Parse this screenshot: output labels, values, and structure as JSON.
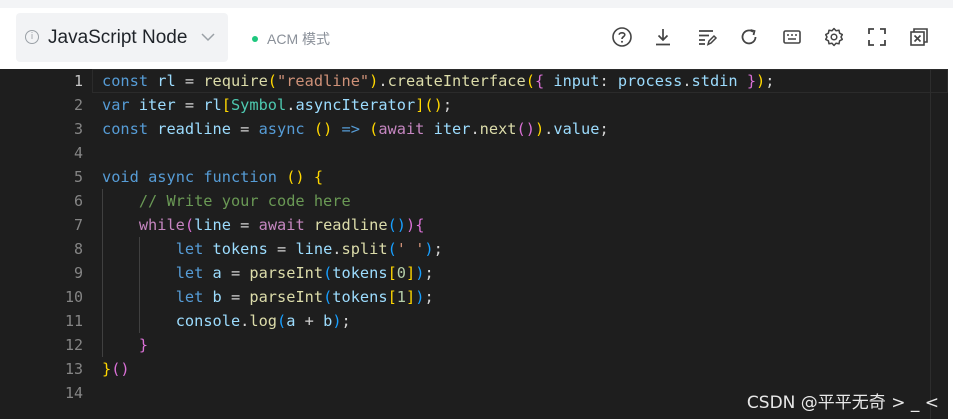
{
  "toolbar": {
    "language": "JavaScript Node",
    "mode": "ACM 模式",
    "colors": {
      "mode_dot": "#1ec77e",
      "editor_bg": "#1e1e1e"
    },
    "tools": [
      {
        "icon": "help-circle-icon"
      },
      {
        "icon": "download-icon"
      },
      {
        "icon": "format-code-icon"
      },
      {
        "icon": "reset-icon"
      },
      {
        "icon": "keyboard-icon"
      },
      {
        "icon": "settings-icon"
      },
      {
        "icon": "fullscreen-icon"
      },
      {
        "icon": "close-panel-icon"
      }
    ]
  },
  "editor": {
    "line_numbers": [
      "1",
      "2",
      "3",
      "4",
      "5",
      "6",
      "7",
      "8",
      "9",
      "10",
      "11",
      "12",
      "13",
      "14"
    ],
    "active_line": "1",
    "lines": [
      [
        [
          "const ",
          "k"
        ],
        [
          "rl",
          "v"
        ],
        [
          " = ",
          "p"
        ],
        [
          "require",
          "f"
        ],
        [
          "(",
          "b1"
        ],
        [
          "\"readline\"",
          "s"
        ],
        [
          ")",
          "b1"
        ],
        [
          ".",
          "p"
        ],
        [
          "createInterface",
          "f"
        ],
        [
          "(",
          "b1"
        ],
        [
          "{",
          "b2"
        ],
        [
          " ",
          "p"
        ],
        [
          "input",
          "v"
        ],
        [
          ": ",
          "p"
        ],
        [
          "process",
          "v"
        ],
        [
          ".",
          "p"
        ],
        [
          "stdin",
          "v"
        ],
        [
          " ",
          "p"
        ],
        [
          "}",
          "b2"
        ],
        [
          ")",
          "b1"
        ],
        [
          ";",
          "p"
        ]
      ],
      [
        [
          "var ",
          "k"
        ],
        [
          "iter",
          "v"
        ],
        [
          " = ",
          "p"
        ],
        [
          "rl",
          "v"
        ],
        [
          "[",
          "b1"
        ],
        [
          "Symbol",
          "t"
        ],
        [
          ".",
          "p"
        ],
        [
          "asyncIterator",
          "v"
        ],
        [
          "]",
          "b1"
        ],
        [
          "(",
          "b1"
        ],
        [
          ")",
          "b1"
        ],
        [
          ";",
          "p"
        ]
      ],
      [
        [
          "const ",
          "k"
        ],
        [
          "readline",
          "v"
        ],
        [
          " = ",
          "p"
        ],
        [
          "async ",
          "k"
        ],
        [
          "()",
          "b1"
        ],
        [
          " => ",
          "k"
        ],
        [
          "(",
          "b1"
        ],
        [
          "await ",
          "ctl"
        ],
        [
          "iter",
          "v"
        ],
        [
          ".",
          "p"
        ],
        [
          "next",
          "f"
        ],
        [
          "()",
          "b2"
        ],
        [
          ")",
          "b1"
        ],
        [
          ".",
          "p"
        ],
        [
          "value",
          "v"
        ],
        [
          ";",
          "p"
        ]
      ],
      [],
      [
        [
          "void ",
          "k"
        ],
        [
          "async ",
          "k"
        ],
        [
          "function ",
          "k"
        ],
        [
          "()",
          "b1"
        ],
        [
          " ",
          "p"
        ],
        [
          "{",
          "b1"
        ]
      ],
      [
        [
          "    ",
          "p"
        ],
        [
          "// Write your code here",
          "c"
        ]
      ],
      [
        [
          "    ",
          "p"
        ],
        [
          "while",
          "ctl"
        ],
        [
          "(",
          "b2"
        ],
        [
          "line",
          "v"
        ],
        [
          " = ",
          "p"
        ],
        [
          "await ",
          "ctl"
        ],
        [
          "readline",
          "f"
        ],
        [
          "()",
          "b3"
        ],
        [
          ")",
          "b2"
        ],
        [
          "{",
          "b2"
        ]
      ],
      [
        [
          "        ",
          "p"
        ],
        [
          "let ",
          "k"
        ],
        [
          "tokens",
          "v"
        ],
        [
          " = ",
          "p"
        ],
        [
          "line",
          "v"
        ],
        [
          ".",
          "p"
        ],
        [
          "split",
          "f"
        ],
        [
          "(",
          "b3"
        ],
        [
          "' '",
          "s"
        ],
        [
          ")",
          "b3"
        ],
        [
          ";",
          "p"
        ]
      ],
      [
        [
          "        ",
          "p"
        ],
        [
          "let ",
          "k"
        ],
        [
          "a",
          "v"
        ],
        [
          " = ",
          "p"
        ],
        [
          "parseInt",
          "f"
        ],
        [
          "(",
          "b3"
        ],
        [
          "tokens",
          "v"
        ],
        [
          "[",
          "b1"
        ],
        [
          "0",
          "n"
        ],
        [
          "]",
          "b1"
        ],
        [
          ")",
          "b3"
        ],
        [
          ";",
          "p"
        ]
      ],
      [
        [
          "        ",
          "p"
        ],
        [
          "let ",
          "k"
        ],
        [
          "b",
          "v"
        ],
        [
          " = ",
          "p"
        ],
        [
          "parseInt",
          "f"
        ],
        [
          "(",
          "b3"
        ],
        [
          "tokens",
          "v"
        ],
        [
          "[",
          "b1"
        ],
        [
          "1",
          "n"
        ],
        [
          "]",
          "b1"
        ],
        [
          ")",
          "b3"
        ],
        [
          ";",
          "p"
        ]
      ],
      [
        [
          "        ",
          "p"
        ],
        [
          "console",
          "v"
        ],
        [
          ".",
          "p"
        ],
        [
          "log",
          "f"
        ],
        [
          "(",
          "b3"
        ],
        [
          "a",
          "v"
        ],
        [
          " + ",
          "p"
        ],
        [
          "b",
          "v"
        ],
        [
          ")",
          "b3"
        ],
        [
          ";",
          "p"
        ]
      ],
      [
        [
          "    ",
          "p"
        ],
        [
          "}",
          "b2"
        ]
      ],
      [
        [
          "}",
          "b1"
        ],
        [
          "()",
          "b2"
        ]
      ],
      []
    ]
  },
  "watermark": "CSDN @平平无奇 > _ <"
}
